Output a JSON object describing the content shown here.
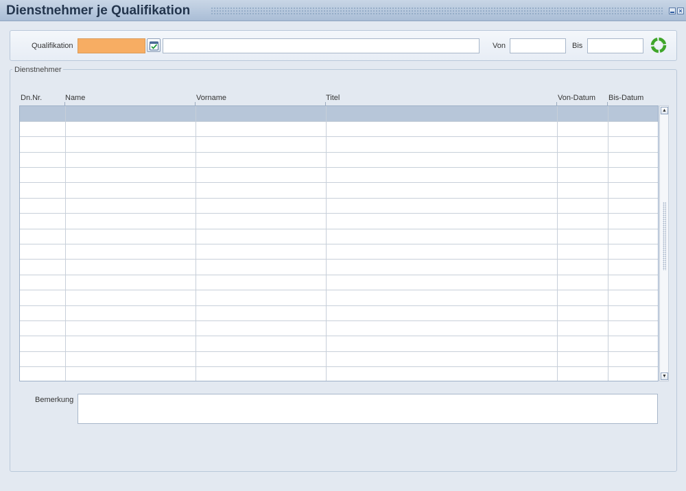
{
  "window": {
    "title": "Dienstnehmer je Qualifikation",
    "minimize_icon": "minimize-icon",
    "close_icon": "close-icon"
  },
  "filter": {
    "qualifikation_label": "Qualifikation",
    "qualifikation_code": "",
    "qualifikation_text": "",
    "lookup_icon": "checklist-icon",
    "von_label": "Von",
    "von_value": "",
    "bis_label": "Bis",
    "bis_value": "",
    "refresh_icon": "refresh-icon",
    "code_color": "#f7ad63"
  },
  "employees": {
    "group_label": "Dienstnehmer",
    "columns": [
      "Dn.Nr.",
      "Name",
      "Vorname",
      "Titel",
      "Von-Datum",
      "Bis-Datum"
    ],
    "selected_row_color": "#b7c6d9",
    "rows": [
      [
        "",
        "",
        "",
        "",
        "",
        ""
      ],
      [
        "",
        "",
        "",
        "",
        "",
        ""
      ],
      [
        "",
        "",
        "",
        "",
        "",
        ""
      ],
      [
        "",
        "",
        "",
        "",
        "",
        ""
      ],
      [
        "",
        "",
        "",
        "",
        "",
        ""
      ],
      [
        "",
        "",
        "",
        "",
        "",
        ""
      ],
      [
        "",
        "",
        "",
        "",
        "",
        ""
      ],
      [
        "",
        "",
        "",
        "",
        "",
        ""
      ],
      [
        "",
        "",
        "",
        "",
        "",
        ""
      ],
      [
        "",
        "",
        "",
        "",
        "",
        ""
      ],
      [
        "",
        "",
        "",
        "",
        "",
        ""
      ],
      [
        "",
        "",
        "",
        "",
        "",
        ""
      ],
      [
        "",
        "",
        "",
        "",
        "",
        ""
      ],
      [
        "",
        "",
        "",
        "",
        "",
        ""
      ],
      [
        "",
        "",
        "",
        "",
        "",
        ""
      ],
      [
        "",
        "",
        "",
        "",
        "",
        ""
      ],
      [
        "",
        "",
        "",
        "",
        "",
        ""
      ],
      [
        "",
        "",
        "",
        "",
        "",
        ""
      ]
    ]
  },
  "remark": {
    "label": "Bemerkung",
    "value": ""
  }
}
